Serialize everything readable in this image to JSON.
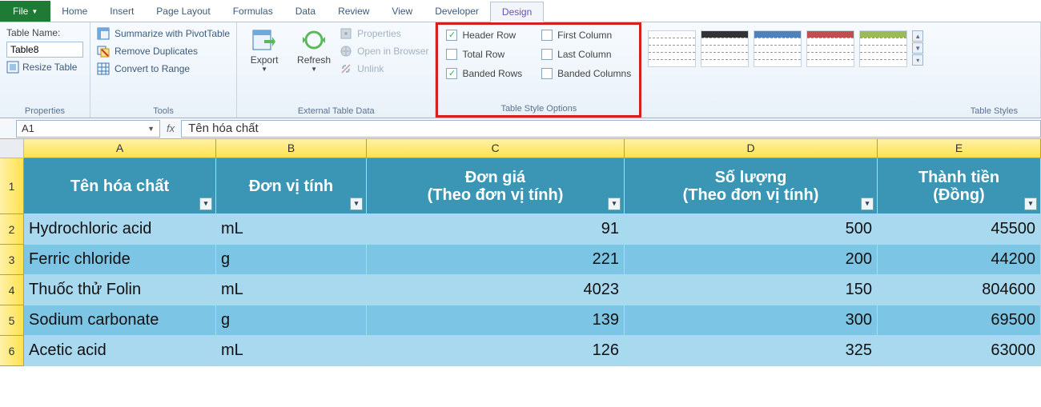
{
  "tabs": {
    "file": "File",
    "list": [
      "Home",
      "Insert",
      "Page Layout",
      "Formulas",
      "Data",
      "Review",
      "View",
      "Developer",
      "Design"
    ],
    "active": "Design"
  },
  "ribbon": {
    "properties": {
      "label": "Properties",
      "table_name_label": "Table Name:",
      "table_name_value": "Table8",
      "resize": "Resize Table"
    },
    "tools": {
      "label": "Tools",
      "pivot": "Summarize with PivotTable",
      "remove_dup": "Remove Duplicates",
      "convert": "Convert to Range"
    },
    "external": {
      "label": "External Table Data",
      "export": "Export",
      "refresh": "Refresh",
      "props": "Properties",
      "browser": "Open in Browser",
      "unlink": "Unlink"
    },
    "style_options": {
      "label": "Table Style Options",
      "header_row": "Header Row",
      "total_row": "Total Row",
      "banded_rows": "Banded Rows",
      "first_col": "First Column",
      "last_col": "Last Column",
      "banded_cols": "Banded Columns"
    },
    "styles": {
      "label": "Table Styles"
    }
  },
  "formula_bar": {
    "cell_ref": "A1",
    "formula": "Tên hóa chất"
  },
  "sheet": {
    "columns": [
      "A",
      "B",
      "C",
      "D",
      "E"
    ],
    "row_numbers": [
      "1",
      "2",
      "3",
      "4",
      "5",
      "6"
    ],
    "headers": {
      "A": "Tên hóa chất",
      "B": "Đơn vị tính",
      "C1": "Đơn giá",
      "C2": "(Theo đơn vị tính)",
      "D1": "Số lượng",
      "D2": "(Theo đơn vị tính)",
      "E1": "Thành tiền",
      "E2": "(Đồng)"
    },
    "rows": [
      {
        "name": "Hydrochloric acid",
        "unit": "mL",
        "price": "91",
        "qty": "500",
        "total": "45500"
      },
      {
        "name": "Ferric chloride",
        "unit": "g",
        "price": "221",
        "qty": "200",
        "total": "44200"
      },
      {
        "name": "Thuốc thử Folin",
        "unit": "mL",
        "price": "4023",
        "qty": "150",
        "total": "804600"
      },
      {
        "name": "Sodium carbonate",
        "unit": "g",
        "price": "139",
        "qty": "300",
        "total": "69500"
      },
      {
        "name": "Acetic acid",
        "unit": "mL",
        "price": "126",
        "qty": "325",
        "total": "63000"
      }
    ]
  },
  "style_thumbs": [
    {
      "header": "#ffffff"
    },
    {
      "header": "#333333"
    },
    {
      "header": "#4f81bd"
    },
    {
      "header": "#c0504d"
    },
    {
      "header": "#9bbb59"
    }
  ]
}
